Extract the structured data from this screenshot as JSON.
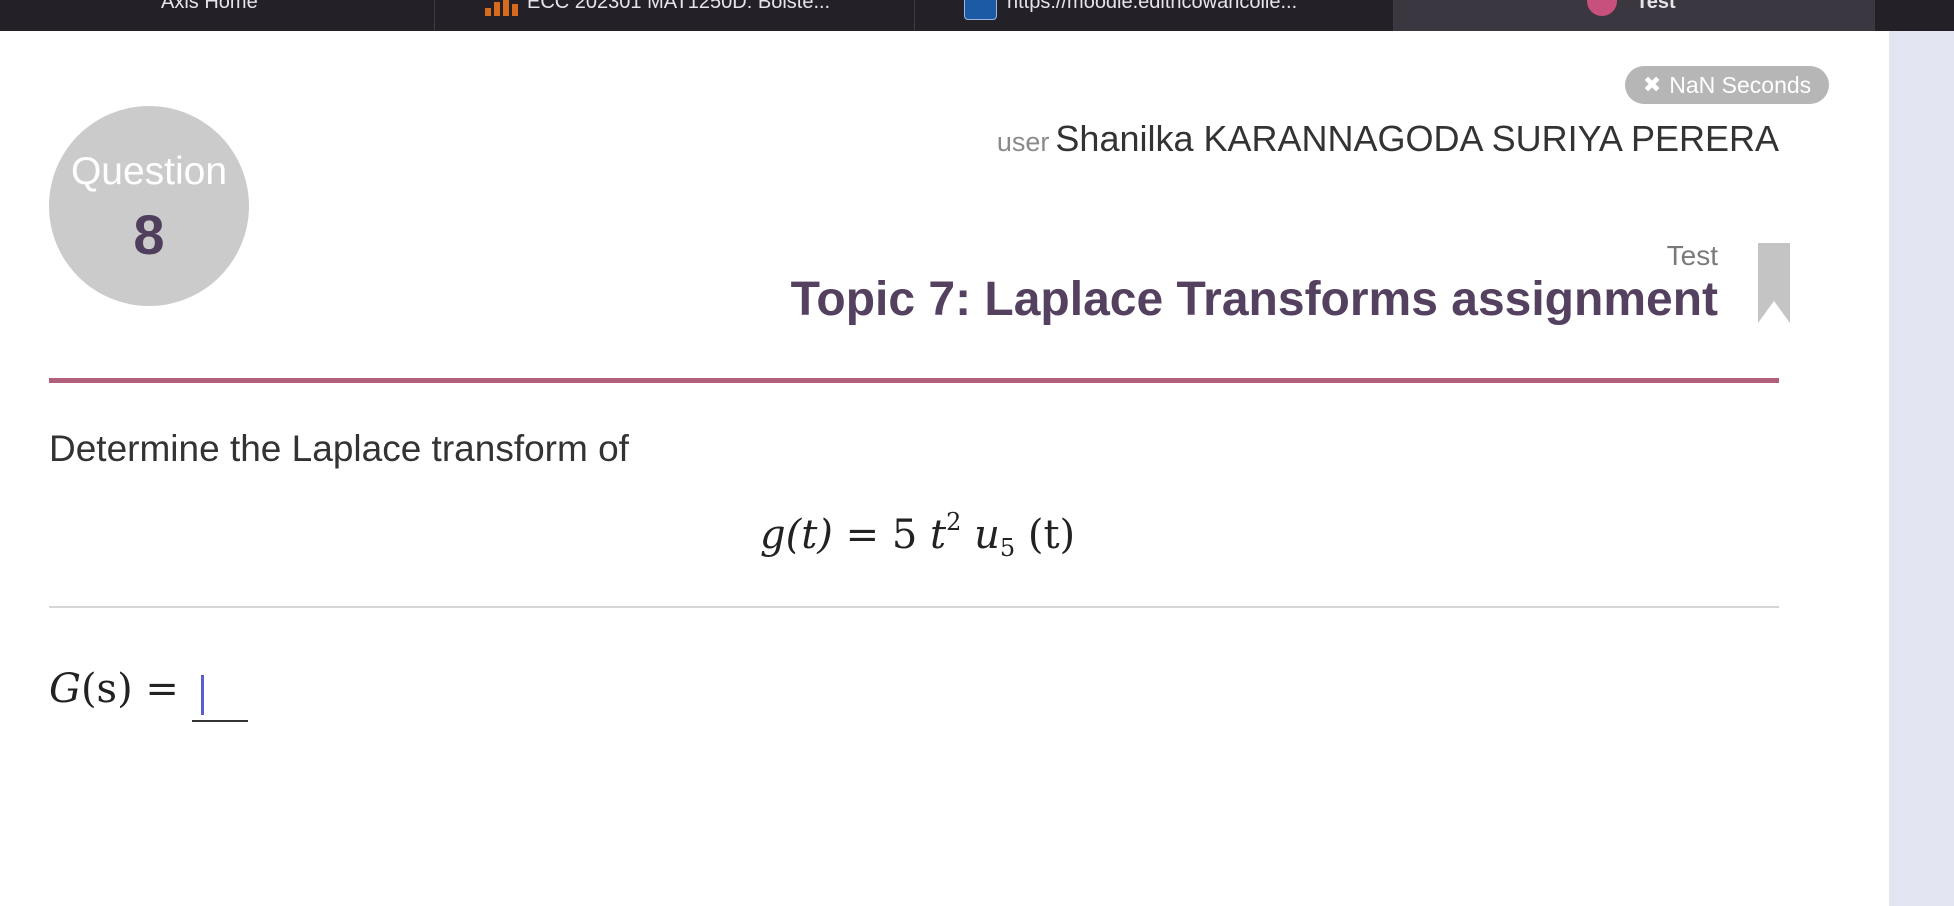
{
  "browser": {
    "tabs": [
      {
        "label": "Axis Home",
        "active": false,
        "icon": "none"
      },
      {
        "label": "ECC 202301 MAT1250D: Bolste...",
        "active": false,
        "icon": "bar-chart-icon"
      },
      {
        "label": "https://moodle.edithcowancolle...",
        "active": false,
        "icon": "moodle-icon"
      },
      {
        "label": "Test",
        "active": true,
        "icon": "tab-favicon-icon"
      }
    ]
  },
  "timer": {
    "icon": "close-icon",
    "label": "NaN Seconds"
  },
  "question": {
    "word": "Question",
    "number": "8"
  },
  "user": {
    "tag": "user",
    "name": "Shanilka KARANNAGODA SURIYA PERERA"
  },
  "assessment": {
    "type_label": "Test",
    "title": "Topic 7: Laplace Transforms assignment"
  },
  "problem": {
    "prompt": "Determine the Laplace transform of",
    "equation": {
      "lhs": "g(t)",
      "coefficient": "5",
      "variable": "t",
      "exponent": "2",
      "step": "u",
      "step_subscript": "5",
      "argument": "(t)"
    }
  },
  "answer": {
    "label_fn": "G",
    "label_arg": "(s)",
    "equals": "=",
    "value": ""
  },
  "colors": {
    "accent": "#b15f7b",
    "title": "#54405f",
    "badge": "#cbcbcb",
    "timer": "#b6b6b6"
  }
}
